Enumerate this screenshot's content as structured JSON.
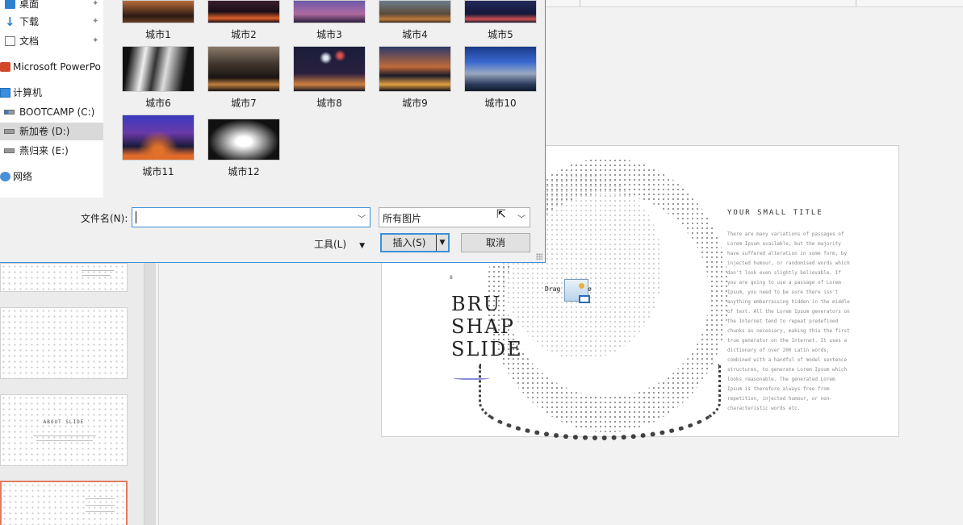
{
  "dialog": {
    "nav_items": [
      {
        "label": "桌面",
        "icon": "desktop-icon",
        "pinned": true
      },
      {
        "label": "下载",
        "icon": "download-icon",
        "pinned": true
      },
      {
        "label": "文档",
        "icon": "document-icon",
        "pinned": true
      },
      {
        "label": "Microsoft PowerPo",
        "icon": "powerpoint-icon",
        "pinned": false
      },
      {
        "label": "计算机",
        "icon": "computer-icon",
        "pinned": false
      },
      {
        "label": "BOOTCAMP (C:)",
        "icon": "drive-icon",
        "pinned": false
      },
      {
        "label": "新加卷 (D:)",
        "icon": "drive-icon",
        "pinned": false,
        "selected": true
      },
      {
        "label": "燕归来 (E:)",
        "icon": "drive-icon",
        "pinned": false
      },
      {
        "label": "网络",
        "icon": "network-icon",
        "pinned": false
      }
    ],
    "files": [
      {
        "name": "城市1"
      },
      {
        "name": "城市2"
      },
      {
        "name": "城市3"
      },
      {
        "name": "城市4"
      },
      {
        "name": "城市5"
      },
      {
        "name": "城市6"
      },
      {
        "name": "城市7"
      },
      {
        "name": "城市8"
      },
      {
        "name": "城市9"
      },
      {
        "name": "城市10"
      },
      {
        "name": "城市11"
      },
      {
        "name": "城市12"
      }
    ],
    "filename_label": "文件名(N):",
    "filename_value": "",
    "filter_value": "所有图片",
    "tools_label": "工具(L)",
    "insert_label": "插入(S)",
    "cancel_label": "取消",
    "pin_glyph": "✦"
  },
  "slide": {
    "placeholder": "Drag a        image",
    "title_lines": [
      "BRU",
      "SHAP",
      "SLIDE"
    ],
    "number": "8",
    "small_title": "YOUR SMALL TITLE",
    "body": "There are many variations of passages of Lorem Ipsum available, but the majority have suffered alteration in some form, by injected humour, or randomised words which don't look even slightly believable. If you are going to use a passage of Lorem Ipsum, you need to be sure there isn't anything embarrassing hidden in the middle of text. All the Lorem Ipsum generators on the Internet tend to repeat predefined chunks as necessary, making this the first true generator on the Internet. It uses a dictionary of over 200 Latin words, combined with a handful of model sentence structures, to generate Lorem Ipsum which looks reasonable. The generated Lorem Ipsum is therefore always free from repetition, injected humour, or non-characteristic words etc."
  },
  "thumbnails": {
    "about_title": "ABOUT SLIDE"
  },
  "colors": {
    "accent": "#3c8fd6",
    "active_thumb": "#e07a5f"
  }
}
